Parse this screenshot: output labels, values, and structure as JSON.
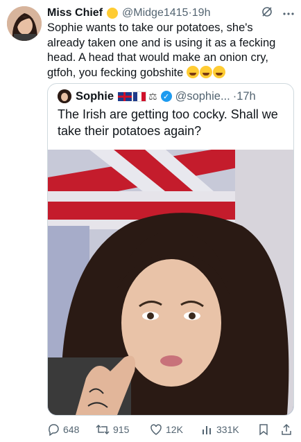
{
  "tweet": {
    "author_name": "Miss Chief",
    "handle": "@Midge1415",
    "separator": "·",
    "time": "19h",
    "text": "Sophie wants to take our potatoes, she's already taken one and is using it as a fecking head. A head that would make an onion cry, gtfoh, you fecking gobshite",
    "emoji_icons": [
      "rofl-emoji",
      "joy-emoji",
      "joy-emoji"
    ]
  },
  "quoted": {
    "author_name": "Sophie",
    "handle": "@sophie...",
    "separator": "·",
    "time": "17h",
    "text": "The Irish are getting too cocky. Shall we take their potatoes again?"
  },
  "actions": {
    "replies": "648",
    "reposts": "915",
    "likes": "12K",
    "views": "331K"
  },
  "colors": {
    "text": "#0f1419",
    "muted": "#536471",
    "border": "#cfd9de",
    "verified": "#1d9bf0"
  }
}
